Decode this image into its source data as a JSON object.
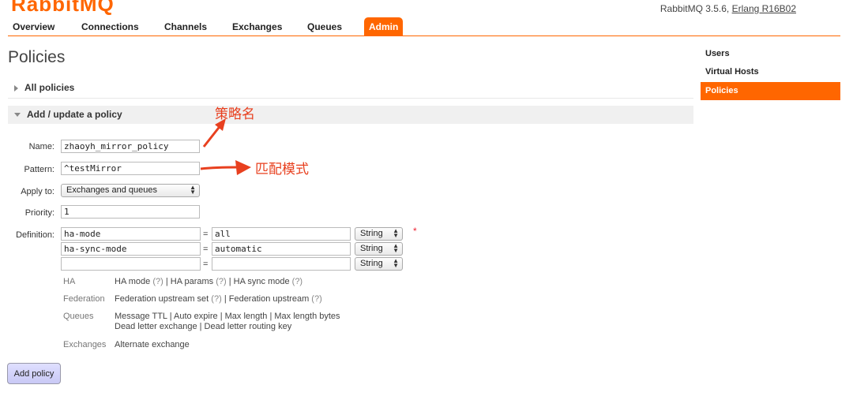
{
  "header": {
    "logo_brand": "RabbitMQ",
    "version": "RabbitMQ 3.5.6,",
    "erlang": "Erlang R16B02",
    "accent_color": "#ff6600"
  },
  "tabs": [
    {
      "label": "Overview"
    },
    {
      "label": "Connections"
    },
    {
      "label": "Channels"
    },
    {
      "label": "Exchanges"
    },
    {
      "label": "Queues"
    },
    {
      "label": "Admin",
      "active": true
    }
  ],
  "page_title": "Policies",
  "sections": {
    "all_policies": "All policies",
    "add_update": "Add / update a policy"
  },
  "form": {
    "name_label": "Name:",
    "name_value": "zhaoyh_mirror_policy",
    "pattern_label": "Pattern:",
    "pattern_value": "^testMirror",
    "apply_label": "Apply to:",
    "apply_value": "Exchanges and queues",
    "priority_label": "Priority:",
    "priority_value": "1",
    "definition_label": "Definition:",
    "definitions": [
      {
        "key": "ha-mode",
        "value": "all",
        "type": "String"
      },
      {
        "key": "ha-sync-mode",
        "value": "automatic",
        "type": "String"
      },
      {
        "key": "",
        "value": "",
        "type": "String"
      }
    ],
    "mandatory_mark": "*",
    "equals": "="
  },
  "help": {
    "ha": {
      "heading": "HA",
      "links": [
        "HA mode",
        "HA params",
        "HA sync mode"
      ]
    },
    "federation": {
      "heading": "Federation",
      "links": [
        "Federation upstream set",
        "Federation upstream"
      ]
    },
    "queues": {
      "heading": "Queues",
      "line1": "Message TTL | Auto expire | Max length | Max length bytes",
      "line2": "Dead letter exchange | Dead letter routing key"
    },
    "exchanges": {
      "heading": "Exchanges",
      "line1": "Alternate exchange"
    },
    "qmark": "(?)",
    "pipe": "|"
  },
  "add_button": "Add policy",
  "sidebar": [
    {
      "label": "Users"
    },
    {
      "label": "Virtual Hosts"
    },
    {
      "label": "Policies",
      "active": true
    }
  ],
  "annotations": {
    "policy_name": "策略名",
    "match_pattern": "匹配模式",
    "color": "#e8401f"
  }
}
